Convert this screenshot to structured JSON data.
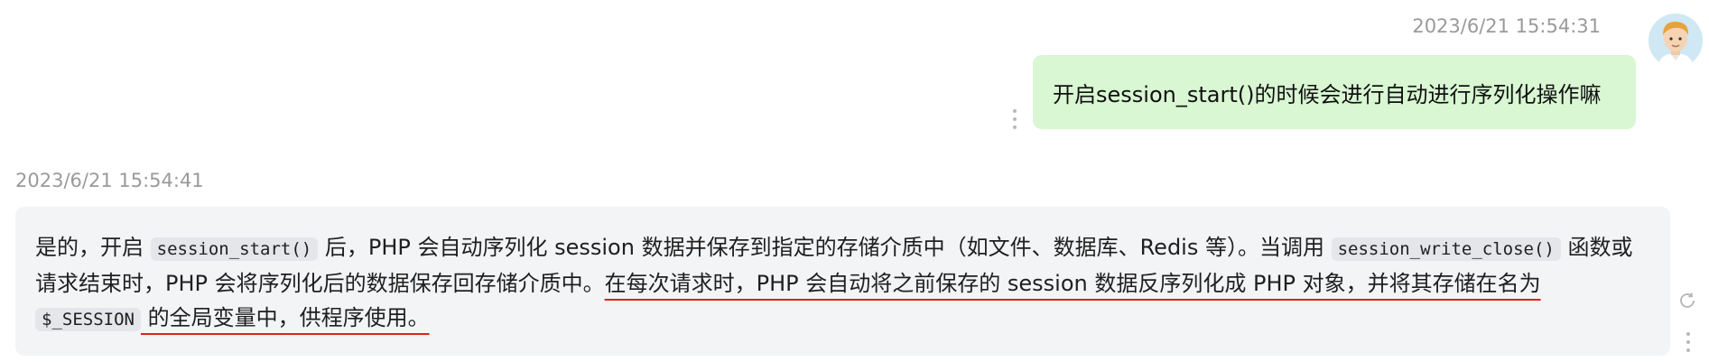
{
  "user_message": {
    "timestamp": "2023/6/21 15:54:31",
    "text": "开启session_start()的时候会进行自动进行序列化操作嘛"
  },
  "bot_message": {
    "timestamp": "2023/6/21 15:54:41",
    "p1": "是的，开启 ",
    "code1": "session_start()",
    "p2": " 后，PHP 会自动序列化 session 数据并保存到指定的存储介质中（如文件、数据库、Redis 等）。当调用 ",
    "code2": "session_write_close()",
    "p3": " 函数或请求结束时，PHP 会将序列化后的数据保存回存储介质中。",
    "p4_highlight": "在每次请求时，PHP 会自动将之前保存的 session 数据反序列化成 PHP 对象，并将其存储在名为 ",
    "code3": "$_SESSION",
    "p5_highlight": " 的全局变量中，供程序使用。"
  },
  "colors": {
    "user_bubble": "#d8f7d2",
    "bot_bubble": "#f3f4f6",
    "underline": "#e0201a",
    "timestamp": "#9a9a9a"
  },
  "icons": [
    "user-avatar-icon",
    "more-vertical-icon",
    "regenerate-icon"
  ]
}
